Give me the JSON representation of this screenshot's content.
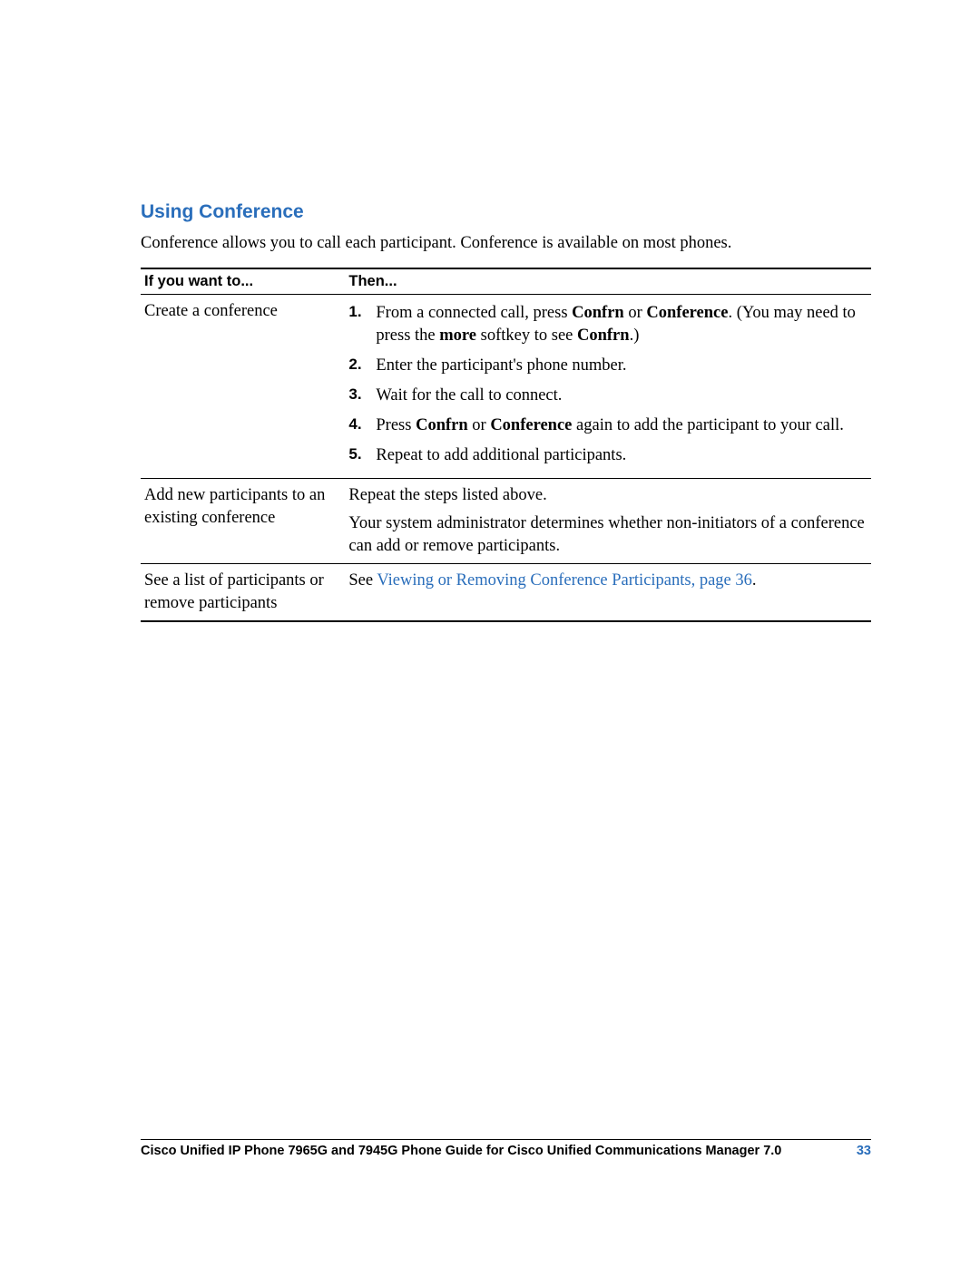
{
  "heading": "Using Conference",
  "intro": "Conference allows you to call each participant. Conference is available on most phones.",
  "table": {
    "headers": {
      "col1": "If you want to...",
      "col2": "Then..."
    },
    "rows": [
      {
        "want": "Create a conference",
        "steps": [
          {
            "pre": "From a connected call, press ",
            "b1": "Confrn",
            "mid": " or ",
            "b2": "Conference",
            "post1": ". (You may need to press the ",
            "b3": "more",
            "post2": " softkey to see ",
            "b4": "Confrn",
            "post3": ".)"
          },
          {
            "text": "Enter the participant's phone number."
          },
          {
            "text": "Wait for the call to connect."
          },
          {
            "pre": "Press ",
            "b1": "Confrn",
            "mid": " or ",
            "b2": "Conference",
            "post": " again to add the participant to your call."
          },
          {
            "text": "Repeat to add additional participants."
          }
        ]
      },
      {
        "want": "Add new participants to an existing conference",
        "then_p1": "Repeat the steps listed above.",
        "then_p2": "Your system administrator determines whether non-initiators of a conference can add or remove participants."
      },
      {
        "want": "See a list of participants or remove participants",
        "then_pre": "See ",
        "then_link": "Viewing or Removing Conference Participants, page 36",
        "then_post": "."
      }
    ]
  },
  "footer": {
    "title": "Cisco Unified IP Phone 7965G and 7945G Phone Guide for Cisco Unified Communications Manager 7.0",
    "page": "33"
  }
}
